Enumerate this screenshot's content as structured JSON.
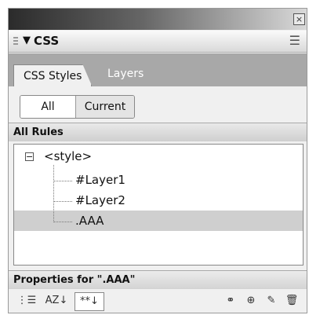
{
  "window": {
    "close_glyph": "×"
  },
  "panel": {
    "title": "CSS",
    "collapse_glyph": "▼",
    "menu_glyph": "☰"
  },
  "tabs": [
    {
      "label": "CSS Styles",
      "active": true
    },
    {
      "label": "Layers",
      "active": false
    }
  ],
  "view_toggle": {
    "all_label": "All",
    "current_label": "Current",
    "selected": "All"
  },
  "sections": {
    "all_rules": "All Rules",
    "properties_for": "Properties for \".AAA\""
  },
  "rules_tree": {
    "toggle_glyph": "−",
    "root": "<style>",
    "children": [
      "#Layer1",
      "#Layer2",
      ".AAA"
    ],
    "selected": ".AAA"
  },
  "toolbar": {
    "category_view": "⋮☰",
    "alpha_view": "AZ↓",
    "show_set": "**↓",
    "attach_icon": "⚭",
    "new_rule_icon": "⊕",
    "edit_icon": "✎",
    "delete_icon": "🗑"
  }
}
